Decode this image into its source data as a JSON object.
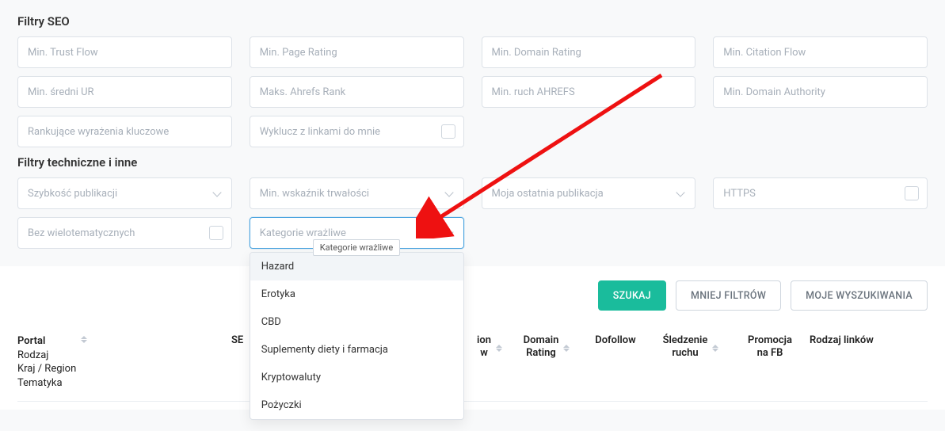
{
  "sections": {
    "seo_title": "Filtry SEO",
    "tech_title": "Filtry techniczne i inne"
  },
  "seo_filters": {
    "min_trust_flow": "Min. Trust Flow",
    "min_page_rating": "Min. Page Rating",
    "min_domain_rating": "Min. Domain Rating",
    "min_citation_flow": "Min. Citation Flow",
    "min_sredni_ur": "Min. średni UR",
    "maks_ahrefs_rank": "Maks. Ahrefs Rank",
    "min_ruch_ahrefs": "Min. ruch AHREFS",
    "min_domain_authority": "Min. Domain Authority",
    "rankujace": "Rankujące wyrażenia kluczowe",
    "wyklucz": "Wyklucz z linkami do mnie"
  },
  "tech_filters": {
    "szybkosc": "Szybkość publikacji",
    "min_wskaznik": "Min. wskaźnik trwałości",
    "moja_ostatnia": "Moja ostatnia publikacja",
    "https": "HTTPS",
    "bez_wielo": "Bez wielotematycznych",
    "kategorie": "Kategorie wrażliwe"
  },
  "dropdown": {
    "tooltip": "Kategorie wrażliwe",
    "options": [
      "Hazard",
      "Erotyka",
      "CBD",
      "Suplementy diety i farmacja",
      "Kryptowaluty",
      "Pożyczki"
    ]
  },
  "buttons": {
    "search": "SZUKAJ",
    "less_filters": "MNIEJ FILTRÓW",
    "my_searches": "MOJE WYSZUKIWANIA"
  },
  "table": {
    "portal": "Portal",
    "portal_sub1": "Rodzaj",
    "portal_sub2": "Kraj / Region",
    "portal_sub3": "Tematyka",
    "seo": "SE",
    "frag_ion": "ion",
    "frag_w": "w",
    "domain_rating_l1": "Domain",
    "domain_rating_l2": "Rating",
    "dofollow": "Dofollow",
    "sledzenie_l1": "Śledzenie",
    "sledzenie_l2": "ruchu",
    "promo_l1": "Promocja",
    "promo_l2": "na FB",
    "rodzaj_linkow": "Rodzaj linków"
  }
}
